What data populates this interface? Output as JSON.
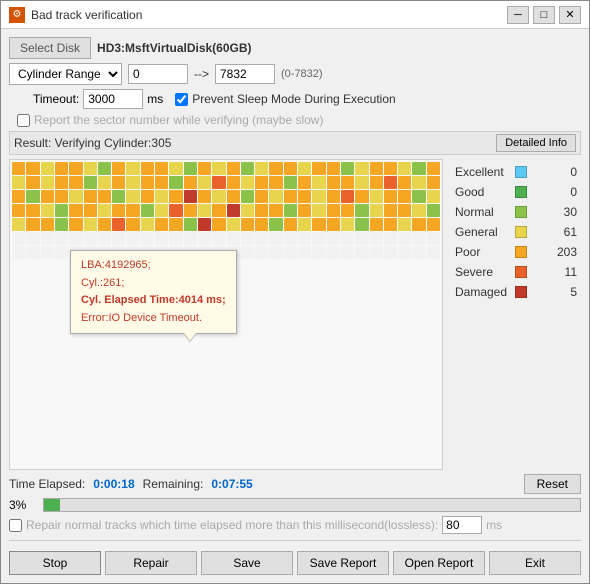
{
  "window": {
    "title": "Bad track verification",
    "icon": "⚙"
  },
  "toolbar": {
    "select_disk_label": "Select Disk",
    "disk_name": "HD3:MsftVirtualDisk(60GB)"
  },
  "cylinder_range": {
    "label": "Cylinder Range",
    "from": "0",
    "arrow": "-->",
    "to": "7832",
    "range_hint": "(0-7832)"
  },
  "timeout": {
    "label": "Timeout:",
    "value": "3000",
    "unit": "ms"
  },
  "checkboxes": {
    "prevent_sleep": "Prevent Sleep Mode During Execution",
    "report_sector": "Report the sector number while verifying (maybe slow)"
  },
  "result": {
    "label": "Result: Verifying Cylinder:305",
    "detailed_btn": "Detailed Info"
  },
  "tooltip": {
    "line1": "LBA:4192965;",
    "line2": "Cyl.:261;",
    "line3": "Cyl. Elapsed Time:4014 ms;",
    "line4": "Error:IO Device Timeout."
  },
  "stats": [
    {
      "label": "Excellent",
      "color": "#5bc8f5",
      "value": "0"
    },
    {
      "label": "Good",
      "color": "#4caf50",
      "value": "0"
    },
    {
      "label": "Normal",
      "color": "#8bc34a",
      "value": "30"
    },
    {
      "label": "General",
      "color": "#e8d44d",
      "value": "61"
    },
    {
      "label": "Poor",
      "color": "#f5a623",
      "value": "203"
    },
    {
      "label": "Severe",
      "color": "#e8622a",
      "value": "11"
    },
    {
      "label": "Damaged",
      "color": "#c0392b",
      "value": "5"
    }
  ],
  "time": {
    "elapsed_label": "Time Elapsed:",
    "elapsed_value": "0:00:18",
    "remaining_label": "Remaining:",
    "remaining_value": "0:07:55",
    "reset_btn": "Reset"
  },
  "progress": {
    "pct": "3%",
    "bar_pct": 3
  },
  "repair": {
    "label": "Repair normal tracks which time elapsed more than this millisecond(lossless):",
    "value": "80",
    "unit": "ms"
  },
  "buttons": {
    "stop": "Stop",
    "repair": "Repair",
    "save": "Save",
    "save_report": "Save Report",
    "open_report": "Open Report",
    "exit": "Exit"
  },
  "grid_colors": {
    "excellent": "#5bc8f5",
    "good": "#4caf50",
    "normal": "#8bc34a",
    "general": "#e8d44d",
    "poor": "#f5a623",
    "severe": "#e8622a",
    "damaged": "#c0392b",
    "empty": "#e8e8e8"
  }
}
